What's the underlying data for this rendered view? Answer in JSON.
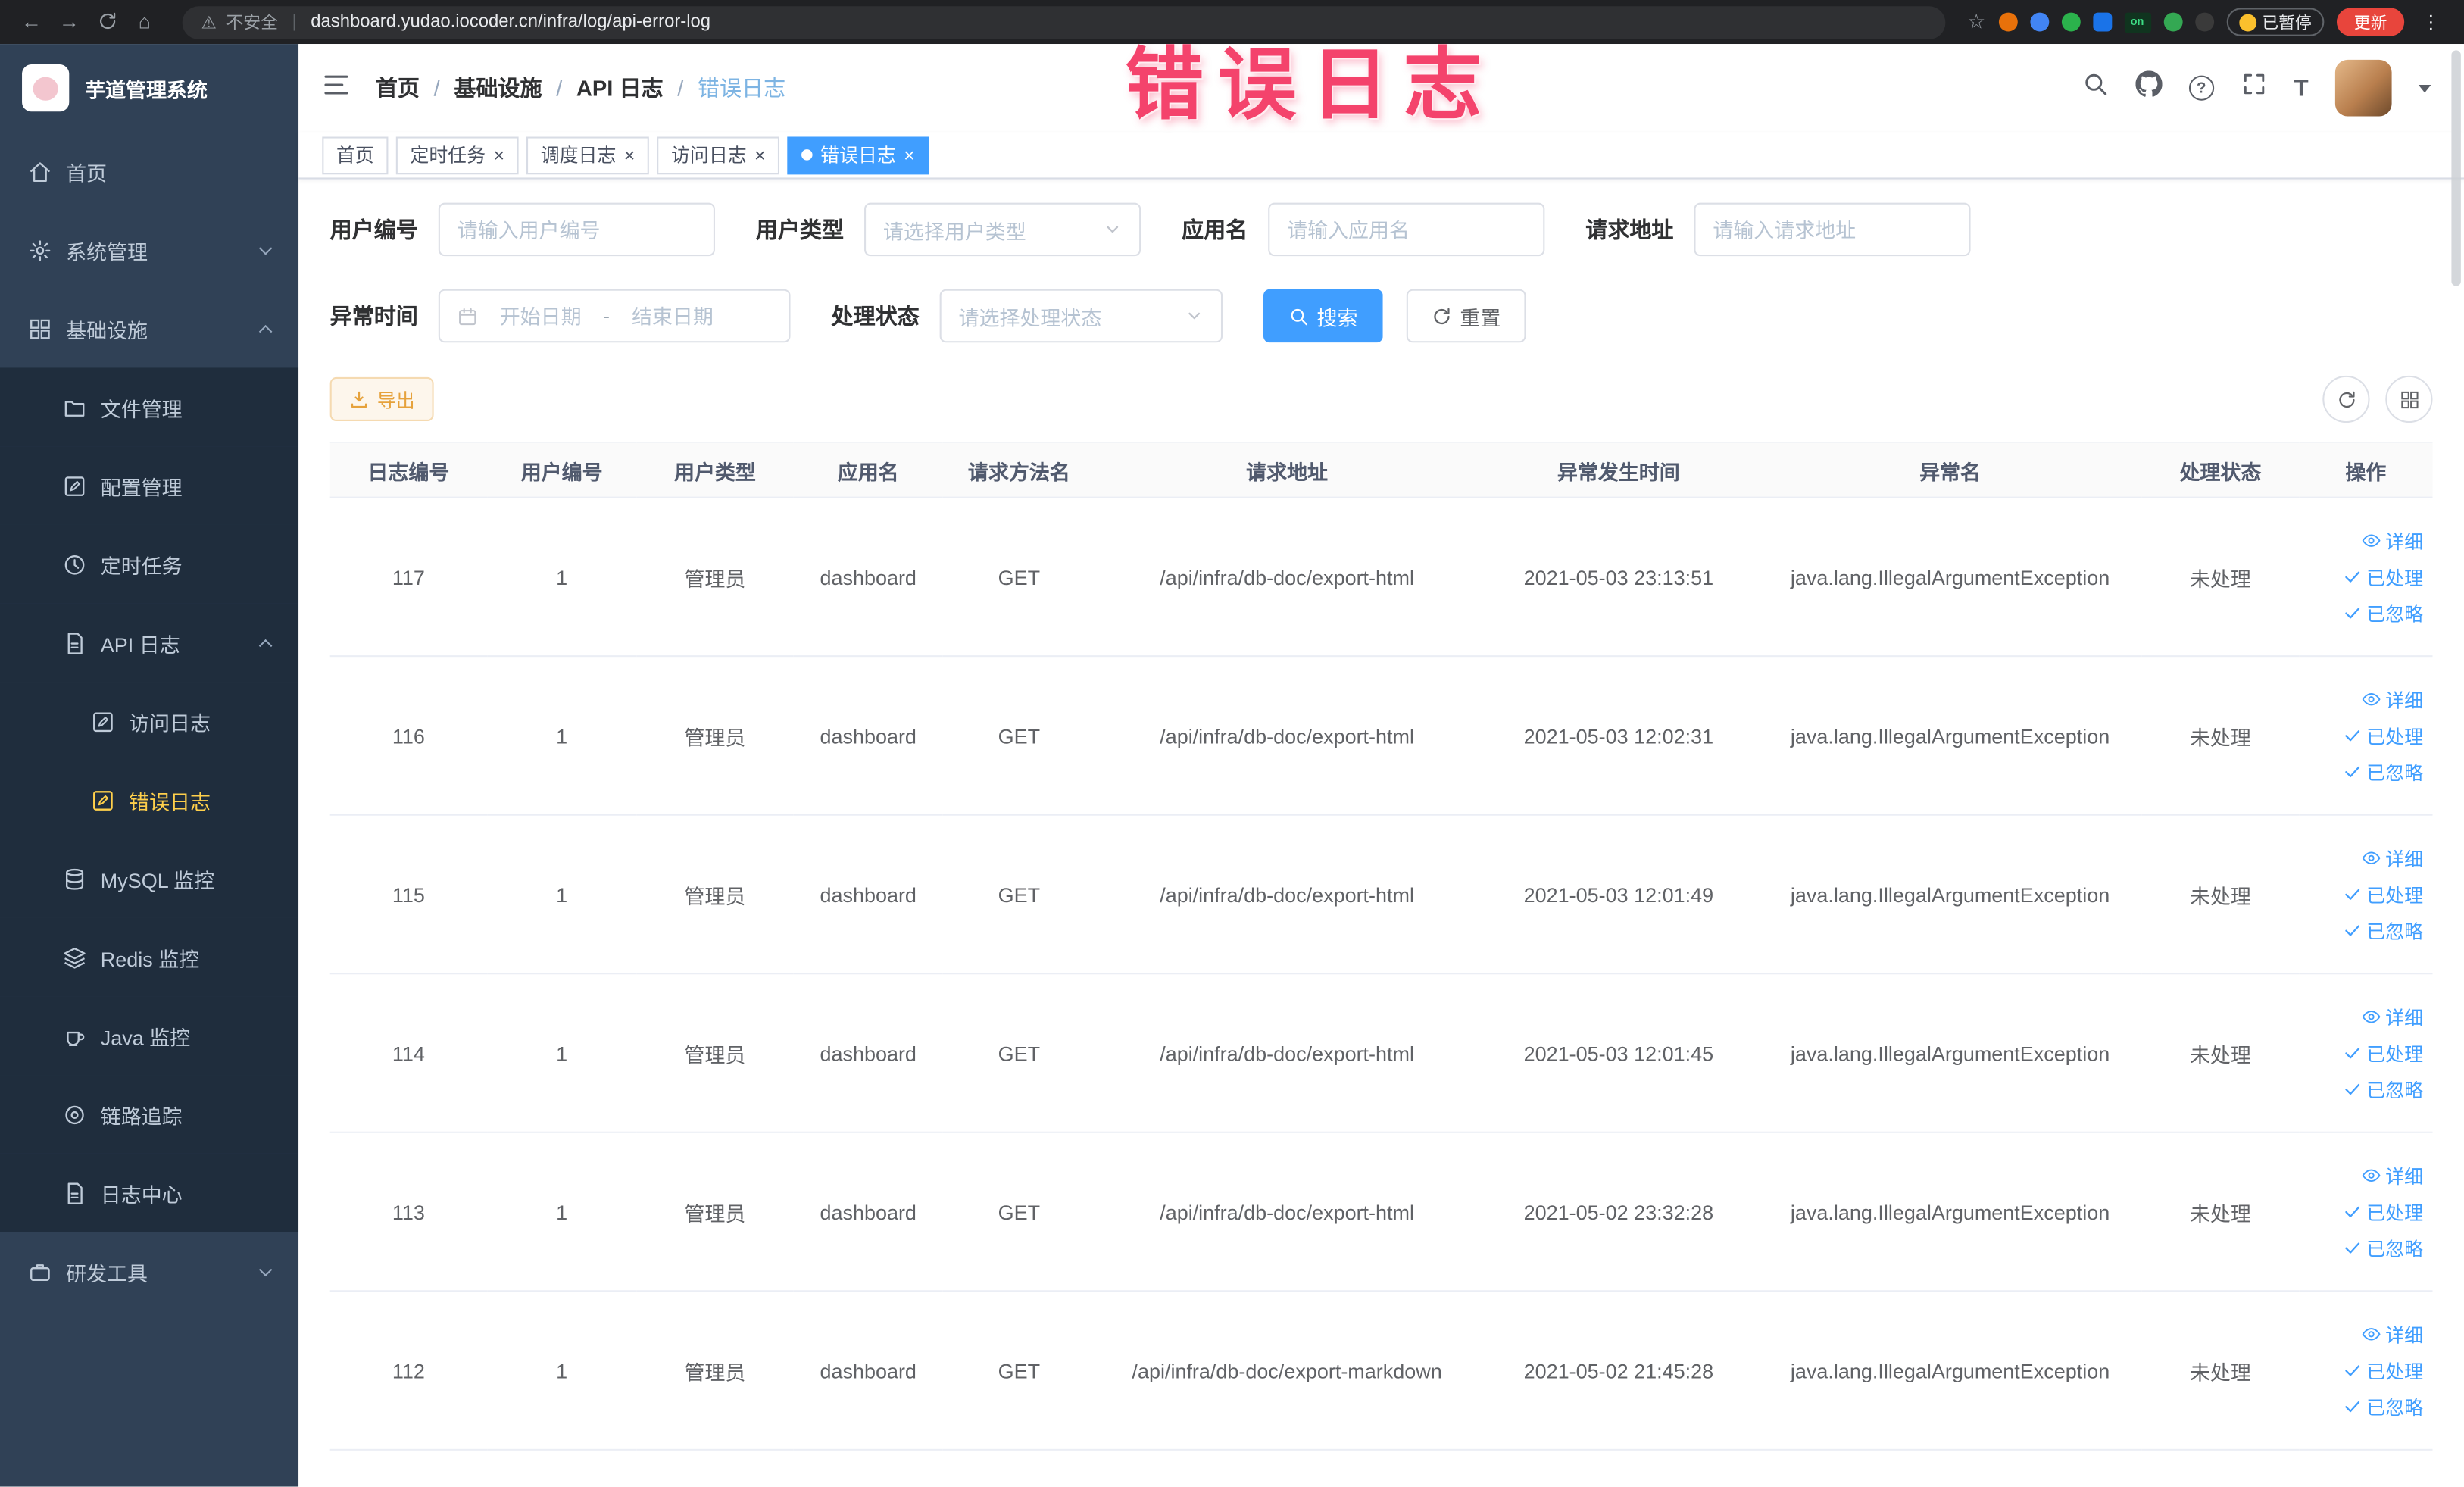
{
  "colors": {
    "accent": "#409eff",
    "sidebar_bg": "#304156",
    "sidebar_submenu_bg": "#1f2d3d",
    "sidebar_active_text": "#ffd04b",
    "warning": "#e6a23c",
    "annotation": "#f4436c"
  },
  "icons": {
    "back": "←",
    "forward": "→",
    "home": "⌂",
    "warning": "⚠",
    "divider": "|",
    "star": "☆",
    "kebab": "⋮",
    "close": "×",
    "textsize": "T"
  },
  "annotation": {
    "text": "错误日志"
  },
  "browser": {
    "security_label": "不安全",
    "url": "dashboard.yudao.iocoder.cn/infra/log/api-error-log",
    "extension_badge": "on",
    "paused_badge": "已暂停",
    "update_button": "更新"
  },
  "sidebar": {
    "logo_title": "芋道管理系统",
    "items": [
      {
        "label": "首页"
      },
      {
        "label": "系统管理"
      },
      {
        "label": "基础设施"
      },
      {
        "label": "文件管理"
      },
      {
        "label": "配置管理"
      },
      {
        "label": "定时任务"
      },
      {
        "label": "API 日志"
      },
      {
        "label": "访问日志"
      },
      {
        "label": "错误日志"
      },
      {
        "label": "MySQL 监控"
      },
      {
        "label": "Redis 监控"
      },
      {
        "label": "Java 监控"
      },
      {
        "label": "链路追踪"
      },
      {
        "label": "日志中心"
      },
      {
        "label": "研发工具"
      }
    ]
  },
  "breadcrumb": {
    "separator": "/",
    "items": [
      "首页",
      "基础设施",
      "API 日志",
      "错误日志"
    ]
  },
  "tabs": [
    {
      "label": "首页"
    },
    {
      "label": "定时任务"
    },
    {
      "label": "调度日志"
    },
    {
      "label": "访问日志"
    },
    {
      "label": "错误日志"
    }
  ],
  "filters": {
    "user_id_label": "用户编号",
    "user_id_placeholder": "请输入用户编号",
    "user_type_label": "用户类型",
    "user_type_placeholder": "请选择用户类型",
    "app_name_label": "应用名",
    "app_name_placeholder": "请输入应用名",
    "request_url_label": "请求地址",
    "request_url_placeholder": "请输入请求地址",
    "time_label": "异常时间",
    "time_start_placeholder": "开始日期",
    "time_separator": "-",
    "time_end_placeholder": "结束日期",
    "status_label": "处理状态",
    "status_placeholder": "请选择处理状态",
    "search_button": "搜索",
    "reset_button": "重置"
  },
  "toolbar": {
    "export_button": "导出"
  },
  "table": {
    "headers": [
      "日志编号",
      "用户编号",
      "用户类型",
      "应用名",
      "请求方法名",
      "请求地址",
      "异常发生时间",
      "异常名",
      "处理状态",
      "操作"
    ],
    "actions": [
      "详细",
      "已处理",
      "已忽略"
    ],
    "rows": [
      {
        "id": "117",
        "user_id": "1",
        "user_type": "管理员",
        "app": "dashboard",
        "method": "GET",
        "url": "/api/infra/db-doc/export-html",
        "time": "2021-05-03 23:13:51",
        "exception": "java.lang.IllegalArgumentException",
        "status": "未处理"
      },
      {
        "id": "116",
        "user_id": "1",
        "user_type": "管理员",
        "app": "dashboard",
        "method": "GET",
        "url": "/api/infra/db-doc/export-html",
        "time": "2021-05-03 12:02:31",
        "exception": "java.lang.IllegalArgumentException",
        "status": "未处理"
      },
      {
        "id": "115",
        "user_id": "1",
        "user_type": "管理员",
        "app": "dashboard",
        "method": "GET",
        "url": "/api/infra/db-doc/export-html",
        "time": "2021-05-03 12:01:49",
        "exception": "java.lang.IllegalArgumentException",
        "status": "未处理"
      },
      {
        "id": "114",
        "user_id": "1",
        "user_type": "管理员",
        "app": "dashboard",
        "method": "GET",
        "url": "/api/infra/db-doc/export-html",
        "time": "2021-05-03 12:01:45",
        "exception": "java.lang.IllegalArgumentException",
        "status": "未处理"
      },
      {
        "id": "113",
        "user_id": "1",
        "user_type": "管理员",
        "app": "dashboard",
        "method": "GET",
        "url": "/api/infra/db-doc/export-html",
        "time": "2021-05-02 23:32:28",
        "exception": "java.lang.IllegalArgumentException",
        "status": "未处理"
      },
      {
        "id": "112",
        "user_id": "1",
        "user_type": "管理员",
        "app": "dashboard",
        "method": "GET",
        "url": "/api/infra/db-doc/export-markdown",
        "time": "2021-05-02 21:45:28",
        "exception": "java.lang.IllegalArgumentException",
        "status": "未处理"
      }
    ]
  }
}
